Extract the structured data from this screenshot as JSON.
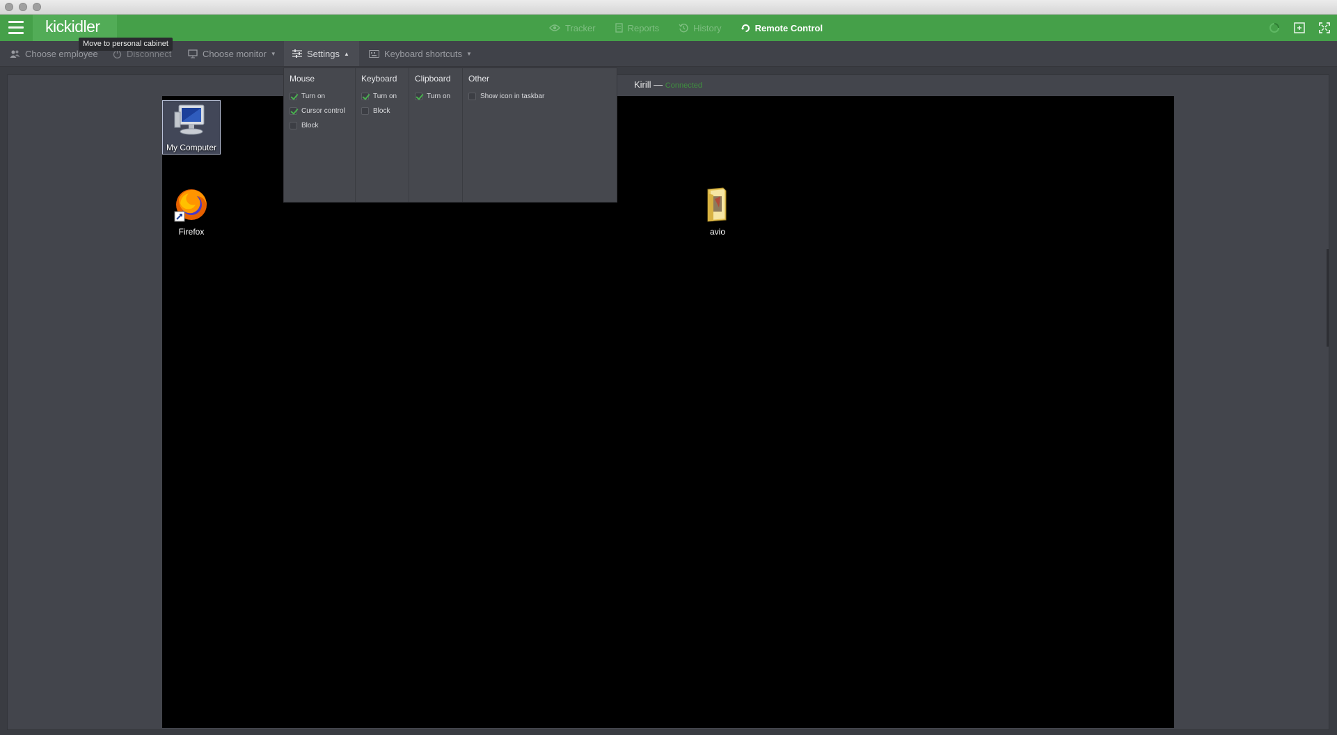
{
  "app": {
    "logo": "kickidler",
    "tooltip": "Move to personal cabinet"
  },
  "nav": {
    "items": [
      {
        "label": "Tracker",
        "icon": "eye-icon",
        "active": false
      },
      {
        "label": "Reports",
        "icon": "document-icon",
        "active": false
      },
      {
        "label": "History",
        "icon": "history-icon",
        "active": false
      },
      {
        "label": "Remote Control",
        "icon": "remote-icon",
        "active": true
      }
    ]
  },
  "toolbar": {
    "choose_employee": "Choose employee",
    "disconnect": "Disconnect",
    "choose_monitor": "Choose monitor",
    "settings": "Settings",
    "keyboard_shortcuts": "Keyboard shortcuts"
  },
  "settings": {
    "mouse": {
      "header": "Mouse",
      "options": [
        {
          "label": "Turn on",
          "checked": true
        },
        {
          "label": "Cursor control",
          "checked": true
        },
        {
          "label": "Block",
          "checked": false
        }
      ]
    },
    "keyboard": {
      "header": "Keyboard",
      "options": [
        {
          "label": "Turn on",
          "checked": true
        },
        {
          "label": "Block",
          "checked": false
        }
      ]
    },
    "clipboard": {
      "header": "Clipboard",
      "options": [
        {
          "label": "Turn on",
          "checked": true
        }
      ]
    },
    "other": {
      "header": "Other",
      "options": [
        {
          "label": "Show icon in taskbar",
          "checked": false
        }
      ]
    }
  },
  "session": {
    "user": "Kirill",
    "separator": "—",
    "status": "Connected"
  },
  "desktop": {
    "icons": [
      {
        "label": "My Computer",
        "icon": "computer-icon",
        "selected": true
      },
      {
        "label": "Firefox",
        "icon": "firefox-icon",
        "selected": false
      },
      {
        "label": "avio",
        "icon": "folder-icon",
        "selected": false
      }
    ]
  },
  "colors": {
    "header_green": "#45a049",
    "accent_check": "#49b04f",
    "background": "#3a3c42"
  }
}
